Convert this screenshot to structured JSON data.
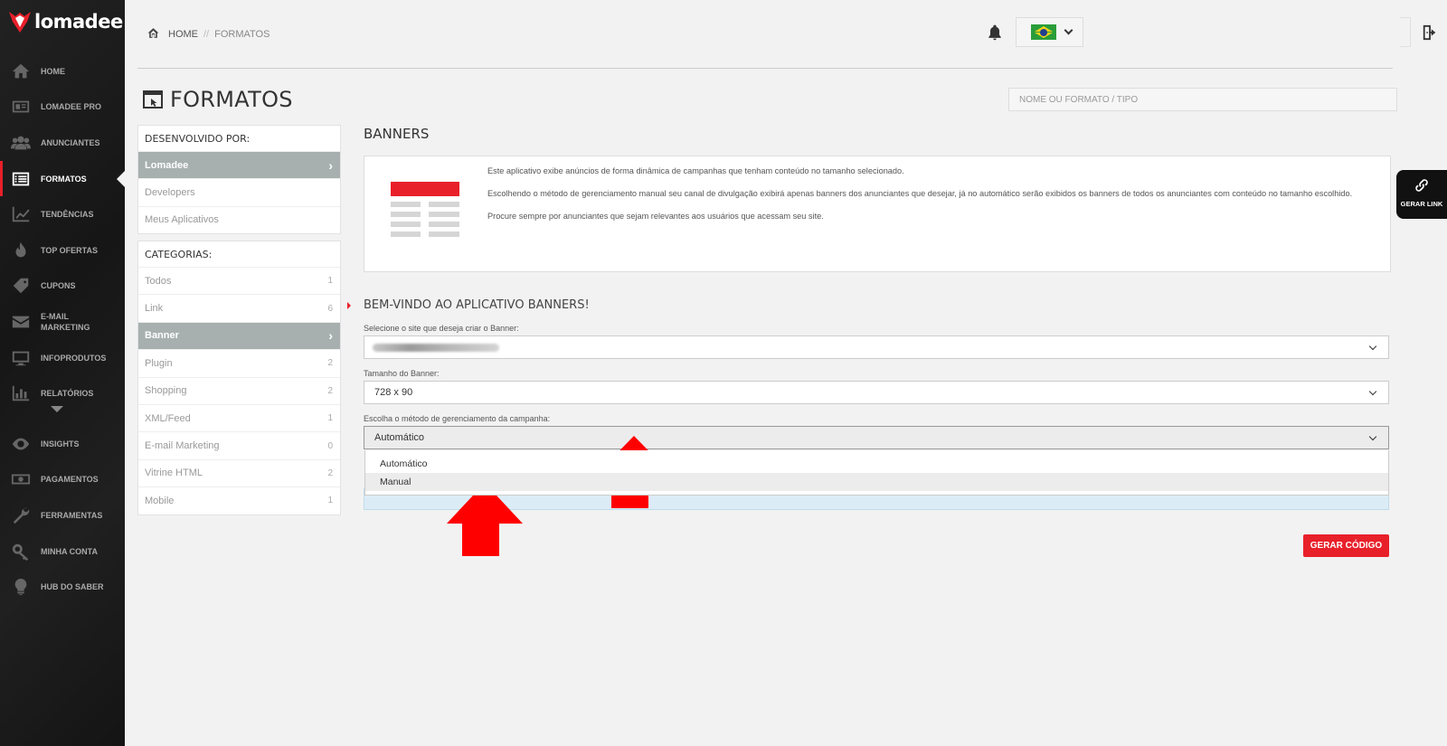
{
  "brand": {
    "name": "lomadee",
    "accent": "#e8202a"
  },
  "sidebar": {
    "items": [
      {
        "label": "HOME",
        "icon": "home-icon"
      },
      {
        "label": "LOMADEE PRO",
        "icon": "id-card-icon"
      },
      {
        "label": "ANUNCIANTES",
        "icon": "users-icon"
      },
      {
        "label": "FORMATOS",
        "icon": "list-icon",
        "active": true
      },
      {
        "label": "TENDÊNCIAS",
        "icon": "trend-icon"
      },
      {
        "label": "TOP OFERTAS",
        "icon": "fire-icon"
      },
      {
        "label": "CUPONS",
        "icon": "ticket-icon"
      },
      {
        "label": "E-MAIL MARKETING",
        "icon": "mail-icon"
      },
      {
        "label": "INFOPRODUTOS",
        "icon": "monitor-icon"
      },
      {
        "label": "RELATÓRIOS",
        "icon": "bar-chart-icon"
      },
      {
        "label": "INSIGHTS",
        "icon": "eye-icon"
      },
      {
        "label": "PAGAMENTOS",
        "icon": "money-icon"
      },
      {
        "label": "FERRAMENTAS",
        "icon": "wrench-icon"
      },
      {
        "label": "MINHA CONTA",
        "icon": "key-icon"
      },
      {
        "label": "HUB DO SABER",
        "icon": "lightbulb-icon"
      }
    ]
  },
  "breadcrumb": {
    "home": "HOME",
    "separator": "//",
    "current": "FORMATOS"
  },
  "page": {
    "title": "FORMATOS",
    "search_placeholder": "NOME OU FORMATO / TIPO"
  },
  "developed_by": {
    "heading": "DESENVOLVIDO POR:",
    "items": [
      {
        "label": "Lomadee",
        "active": true
      },
      {
        "label": "Developers"
      },
      {
        "label": "Meus Aplicativos"
      }
    ]
  },
  "categories": {
    "heading": "CATEGORIAS:",
    "items": [
      {
        "label": "Todos",
        "count": "1"
      },
      {
        "label": "Link",
        "count": "6"
      },
      {
        "label": "Banner",
        "active": true
      },
      {
        "label": "Plugin",
        "count": "2"
      },
      {
        "label": "Shopping",
        "count": "2"
      },
      {
        "label": "XML/Feed",
        "count": "1"
      },
      {
        "label": "E-mail Marketing",
        "count": "0"
      },
      {
        "label": "Vitrine HTML",
        "count": "2"
      },
      {
        "label": "Mobile",
        "count": "1"
      }
    ]
  },
  "banners": {
    "title": "BANNERS",
    "desc": [
      "Este aplicativo exibe anúncios de forma dinâmica de campanhas que tenham conteúdo no tamanho selecionado.",
      "Escolhendo o método de gerenciamento manual seu canal de divulgação exibirá apenas banners dos anunciantes que desejar, já no automático serão exibidos os banners de todos os anunciantes com conteúdo no tamanho escolhido.",
      "Procure sempre por anunciantes que sejam relevantes aos usuários que acessam seu site."
    ]
  },
  "form": {
    "welcome": "BEM-VINDO AO APLICATIVO BANNERS!",
    "site_label": "Selecione o site que deseja criar o Banner:",
    "size_label": "Tamanho do Banner:",
    "size_value": "728 x 90",
    "method_label": "Escolha o método de gerenciamento da campanha:",
    "method_value": "Automático",
    "method_options": [
      "Automático",
      "Manual"
    ],
    "submit": "GERAR CÓDIGO"
  },
  "gerar_link": "GERAR LINK"
}
